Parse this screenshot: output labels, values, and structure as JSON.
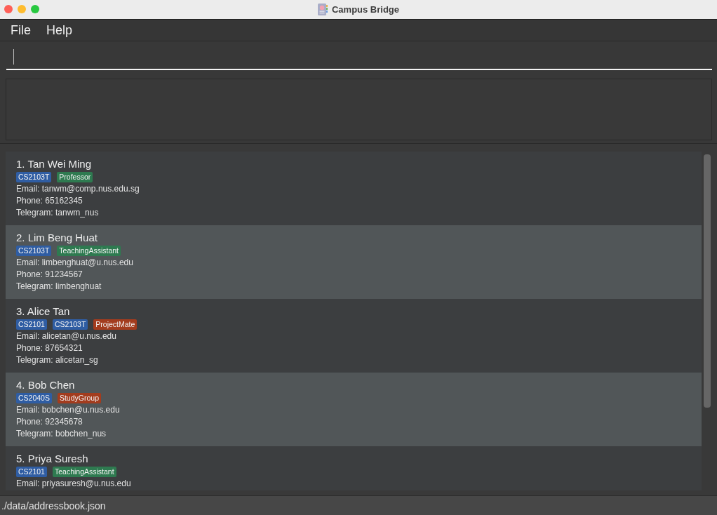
{
  "window": {
    "title": "Campus Bridge"
  },
  "menu": [
    {
      "label": "File"
    },
    {
      "label": "Help"
    }
  ],
  "persons": [
    {
      "title": "1. Tan Wei Ming",
      "tags": [
        {
          "label": "CS2103T",
          "color": "#2f5da3"
        },
        {
          "label": "Professor",
          "color": "#2e7a50"
        }
      ],
      "email": "Email: tanwm@comp.nus.edu.sg",
      "phone": "Phone: 65162345",
      "telegram": "Telegram: tanwm_nus"
    },
    {
      "title": "2. Lim Beng Huat",
      "tags": [
        {
          "label": "CS2103T",
          "color": "#2f5da3"
        },
        {
          "label": "TeachingAssistant",
          "color": "#2e7a50"
        }
      ],
      "email": "Email: limbenghuat@u.nus.edu",
      "phone": "Phone: 91234567",
      "telegram": "Telegram: limbenghuat"
    },
    {
      "title": "3. Alice Tan",
      "tags": [
        {
          "label": "CS2101",
          "color": "#2f5da3"
        },
        {
          "label": "CS2103T",
          "color": "#2f5da3"
        },
        {
          "label": "ProjectMate",
          "color": "#a33c1e"
        }
      ],
      "email": "Email: alicetan@u.nus.edu",
      "phone": "Phone: 87654321",
      "telegram": "Telegram: alicetan_sg"
    },
    {
      "title": "4. Bob Chen",
      "tags": [
        {
          "label": "CS2040S",
          "color": "#2f5da3"
        },
        {
          "label": "StudyGroup",
          "color": "#a33c1e"
        }
      ],
      "email": "Email: bobchen@u.nus.edu",
      "phone": "Phone: 92345678",
      "telegram": "Telegram: bobchen_nus"
    },
    {
      "title": "5. Priya Suresh",
      "tags": [
        {
          "label": "CS2101",
          "color": "#2f5da3"
        },
        {
          "label": "TeachingAssistant",
          "color": "#2e7a50"
        }
      ],
      "email": "Email: priyasuresh@u.nus.edu"
    }
  ],
  "status_bar": {
    "path": "./data/addressbook.json"
  }
}
